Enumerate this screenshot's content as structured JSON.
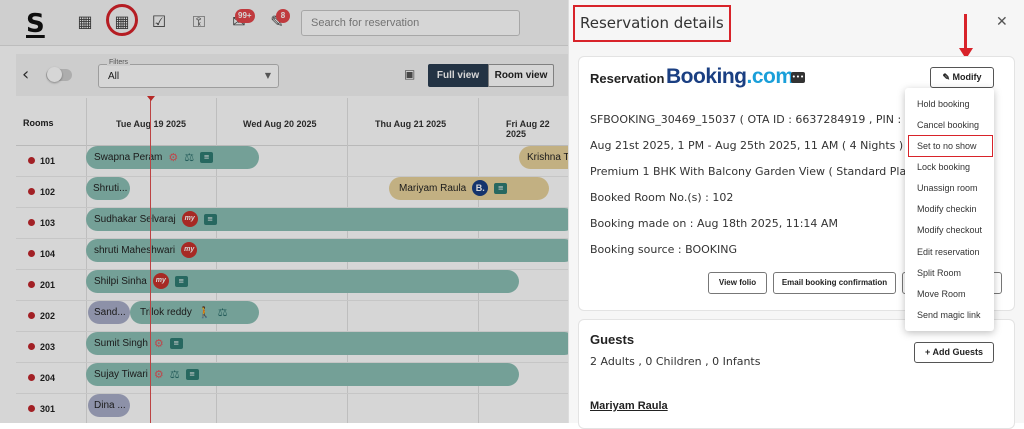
{
  "app": {
    "logo": "S"
  },
  "topbar": {
    "search_placeholder": "Search for reservation",
    "badges": {
      "messages": "99+",
      "notes": "8"
    }
  },
  "toolbar": {
    "filter_label": "Filters",
    "filter_value": "All",
    "full_view": "Full view",
    "room_view": "Room view"
  },
  "grid": {
    "rooms_header": "Rooms",
    "dates": [
      "Tue Aug 19 2025",
      "Wed Aug 20 2025",
      "Thu Aug 21 2025",
      "Fri Aug 22 2025"
    ],
    "rooms": [
      "101",
      "102",
      "103",
      "104",
      "201",
      "202",
      "203",
      "204",
      "301"
    ],
    "bookings": {
      "r101a": "Swapna Peram",
      "r101b": "Krishna T",
      "r102a": "Shruti...",
      "r102b": "Mariyam Raula",
      "r103": "Sudhakar Selvaraj",
      "r104": "shruti Maheshwari",
      "r201": "Shilpi Sinha",
      "r202a": "Sand...",
      "r202b": "Trilok reddy",
      "r203": "Sumit Singh",
      "r204": "Sujay Tiwari",
      "r301": "Dina ..."
    }
  },
  "panel": {
    "title": "Reservation details",
    "reservation_label": "Reservation",
    "ota_logo": {
      "main": "Booking",
      "suffix": ".com"
    },
    "modify": "Modify",
    "lines": {
      "id": "SFBOOKING_30469_15037 ( OTA ID : 6637284919 , PIN : ozg2iOe )",
      "dates": "Aug 21st 2025, 1 PM - Aug 25th 2025, 11 AM ( 4 Nights )",
      "room_type": "Premium 1 BHK With Balcony Garden View ( Standard Plan )",
      "booked_rooms": "Booked Room No.(s) : 102",
      "made_on": "Booking made on : Aug 18th 2025, 11:14 AM",
      "source": "Booking source : BOOKING"
    },
    "view_folio": "View folio",
    "email_confirmation": "Email booking confirmation",
    "guests_label": "Guests",
    "guests_count": "2 Adults , 0 Children , 0 Infants",
    "add_guests": "Add Guests",
    "guest_name": "Mariyam Raula"
  },
  "modify_menu": [
    "Hold booking",
    "Cancel booking",
    "Set to no show",
    "Lock booking",
    "Unassign room",
    "Modify checkin",
    "Modify checkout",
    "Edit reservation",
    "Split Room",
    "Move Room",
    "Send magic link"
  ],
  "colors": {
    "accent_dark": "#2a3d52",
    "booking_teal": "#8bbfb4",
    "booking_beige": "#e8d29b",
    "booking_lavender": "#a9adc9",
    "highlight_red": "#d8232a"
  }
}
